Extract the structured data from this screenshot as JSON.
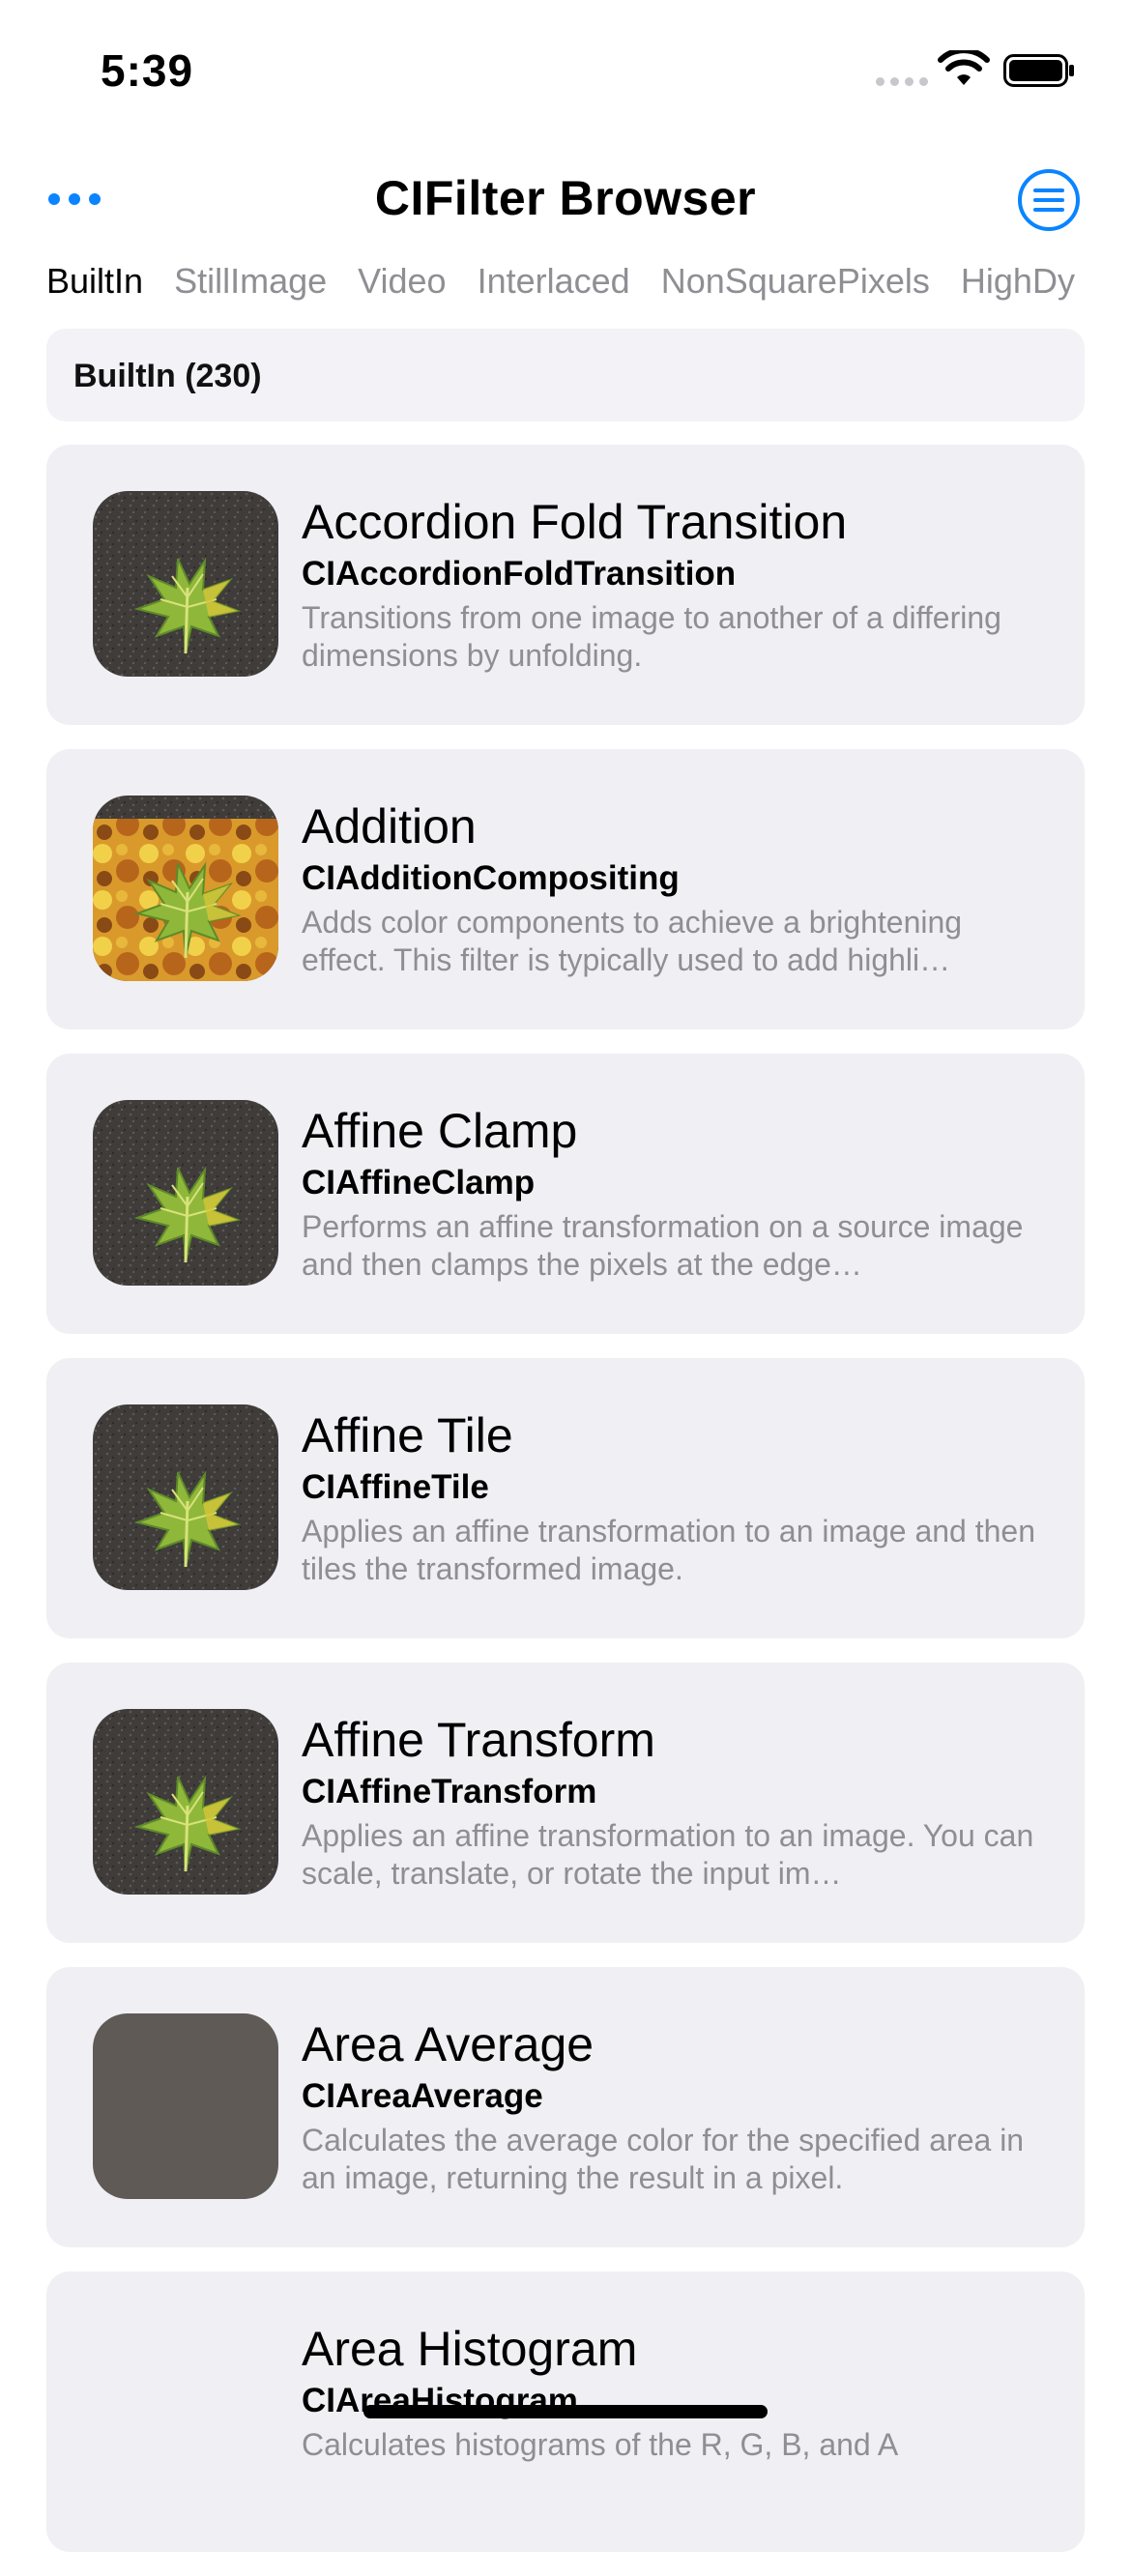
{
  "status": {
    "time": "5:39"
  },
  "nav": {
    "title": "CIFilter Browser"
  },
  "tabs": [
    "BuiltIn",
    "StillImage",
    "Video",
    "Interlaced",
    "NonSquarePixels",
    "HighDy"
  ],
  "section": {
    "header": "BuiltIn (230)"
  },
  "filters": [
    {
      "title": "Accordion Fold Transition",
      "class_name": "CIAccordionFoldTransition",
      "description": "Transitions from one image to another of a differing dimensions by unfolding.",
      "thumb": "leaf-on-asphalt-icon"
    },
    {
      "title": "Addition",
      "class_name": "CIAdditionCompositing",
      "description": "Adds color components to achieve a brightening effect. This filter is typically used to add highli…",
      "thumb": "leaf-on-autumn-leaves-icon"
    },
    {
      "title": "Affine Clamp",
      "class_name": "CIAffineClamp",
      "description": "Performs an affine transformation on a source image and then clamps the pixels at the edge…",
      "thumb": "leaf-on-asphalt-icon"
    },
    {
      "title": "Affine Tile",
      "class_name": "CIAffineTile",
      "description": "Applies an affine transformation to an image and then tiles the transformed image.",
      "thumb": "leaf-on-asphalt-icon"
    },
    {
      "title": "Affine Transform",
      "class_name": "CIAffineTransform",
      "description": "Applies an affine transformation to an image. You can scale, translate, or rotate the input im…",
      "thumb": "leaf-on-asphalt-icon"
    },
    {
      "title": "Area Average",
      "class_name": "CIAreaAverage",
      "description": "Calculates the average color for the specified area in an image, returning the result in a pixel.",
      "thumb": "solid-average-color-icon"
    },
    {
      "title": "Area Histogram",
      "class_name": "CIAreaHistogram",
      "description": "Calculates histograms of the R, G, B, and A",
      "thumb": ""
    }
  ],
  "colors": {
    "accent": "#0a84ff",
    "card_bg": "#efeff4",
    "secondary_text": "#8e8e93",
    "average_swatch": "#5f5a55"
  }
}
